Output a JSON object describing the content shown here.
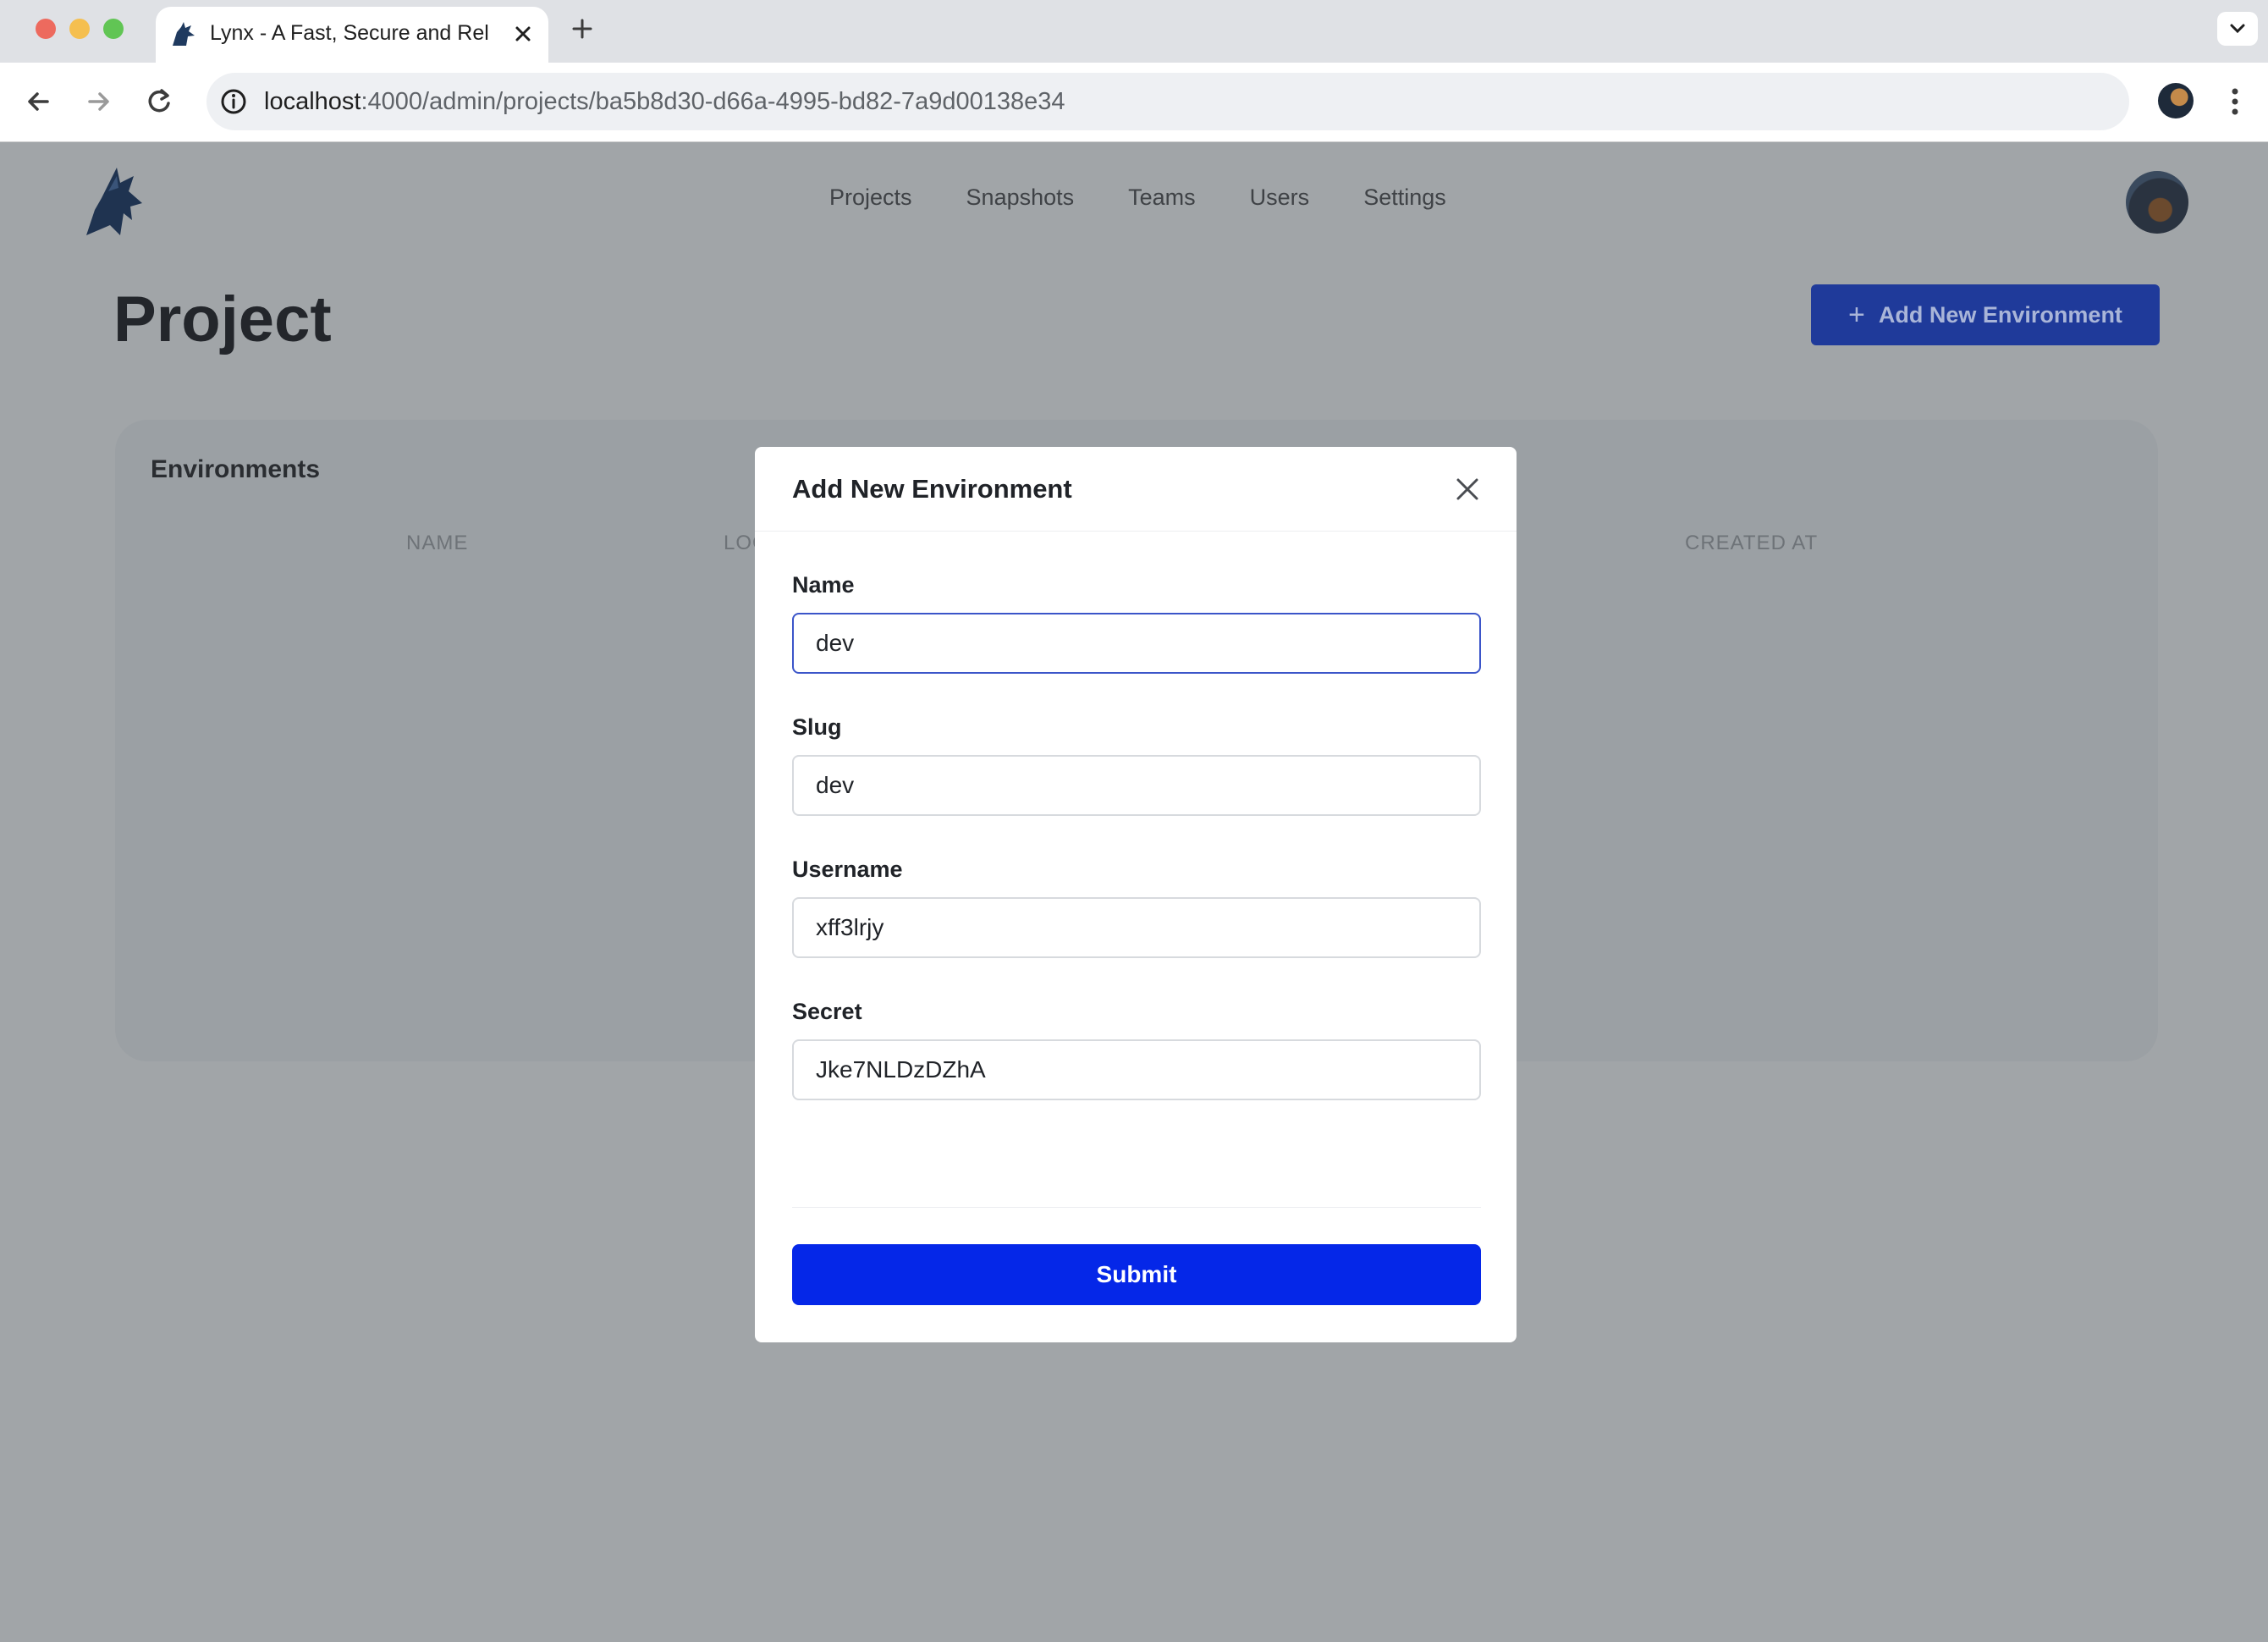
{
  "browser": {
    "tab_title": "Lynx - A Fast, Secure and Rel",
    "url_host": "localhost",
    "url_path": ":4000/admin/projects/ba5b8d30-d66a-4995-bd82-7a9d00138e34"
  },
  "nav": {
    "items": [
      {
        "label": "Projects"
      },
      {
        "label": "Snapshots"
      },
      {
        "label": "Teams"
      },
      {
        "label": "Users"
      },
      {
        "label": "Settings"
      }
    ]
  },
  "page": {
    "title": "Project",
    "add_button_icon": "+",
    "add_button_label": "Add New Environment"
  },
  "environments": {
    "title": "Environments",
    "columns": [
      "NAME",
      "LOC",
      "CREATED AT"
    ]
  },
  "modal": {
    "title": "Add New Environment",
    "fields": [
      {
        "label": "Name",
        "value": "dev"
      },
      {
        "label": "Slug",
        "value": "dev"
      },
      {
        "label": "Username",
        "value": "xff3lrjy"
      },
      {
        "label": "Secret",
        "value": "Jke7NLDzDZhA"
      }
    ],
    "submit_label": "Submit"
  },
  "colors": {
    "accent": "#0527e8",
    "overlay": "#a1a5a8"
  }
}
